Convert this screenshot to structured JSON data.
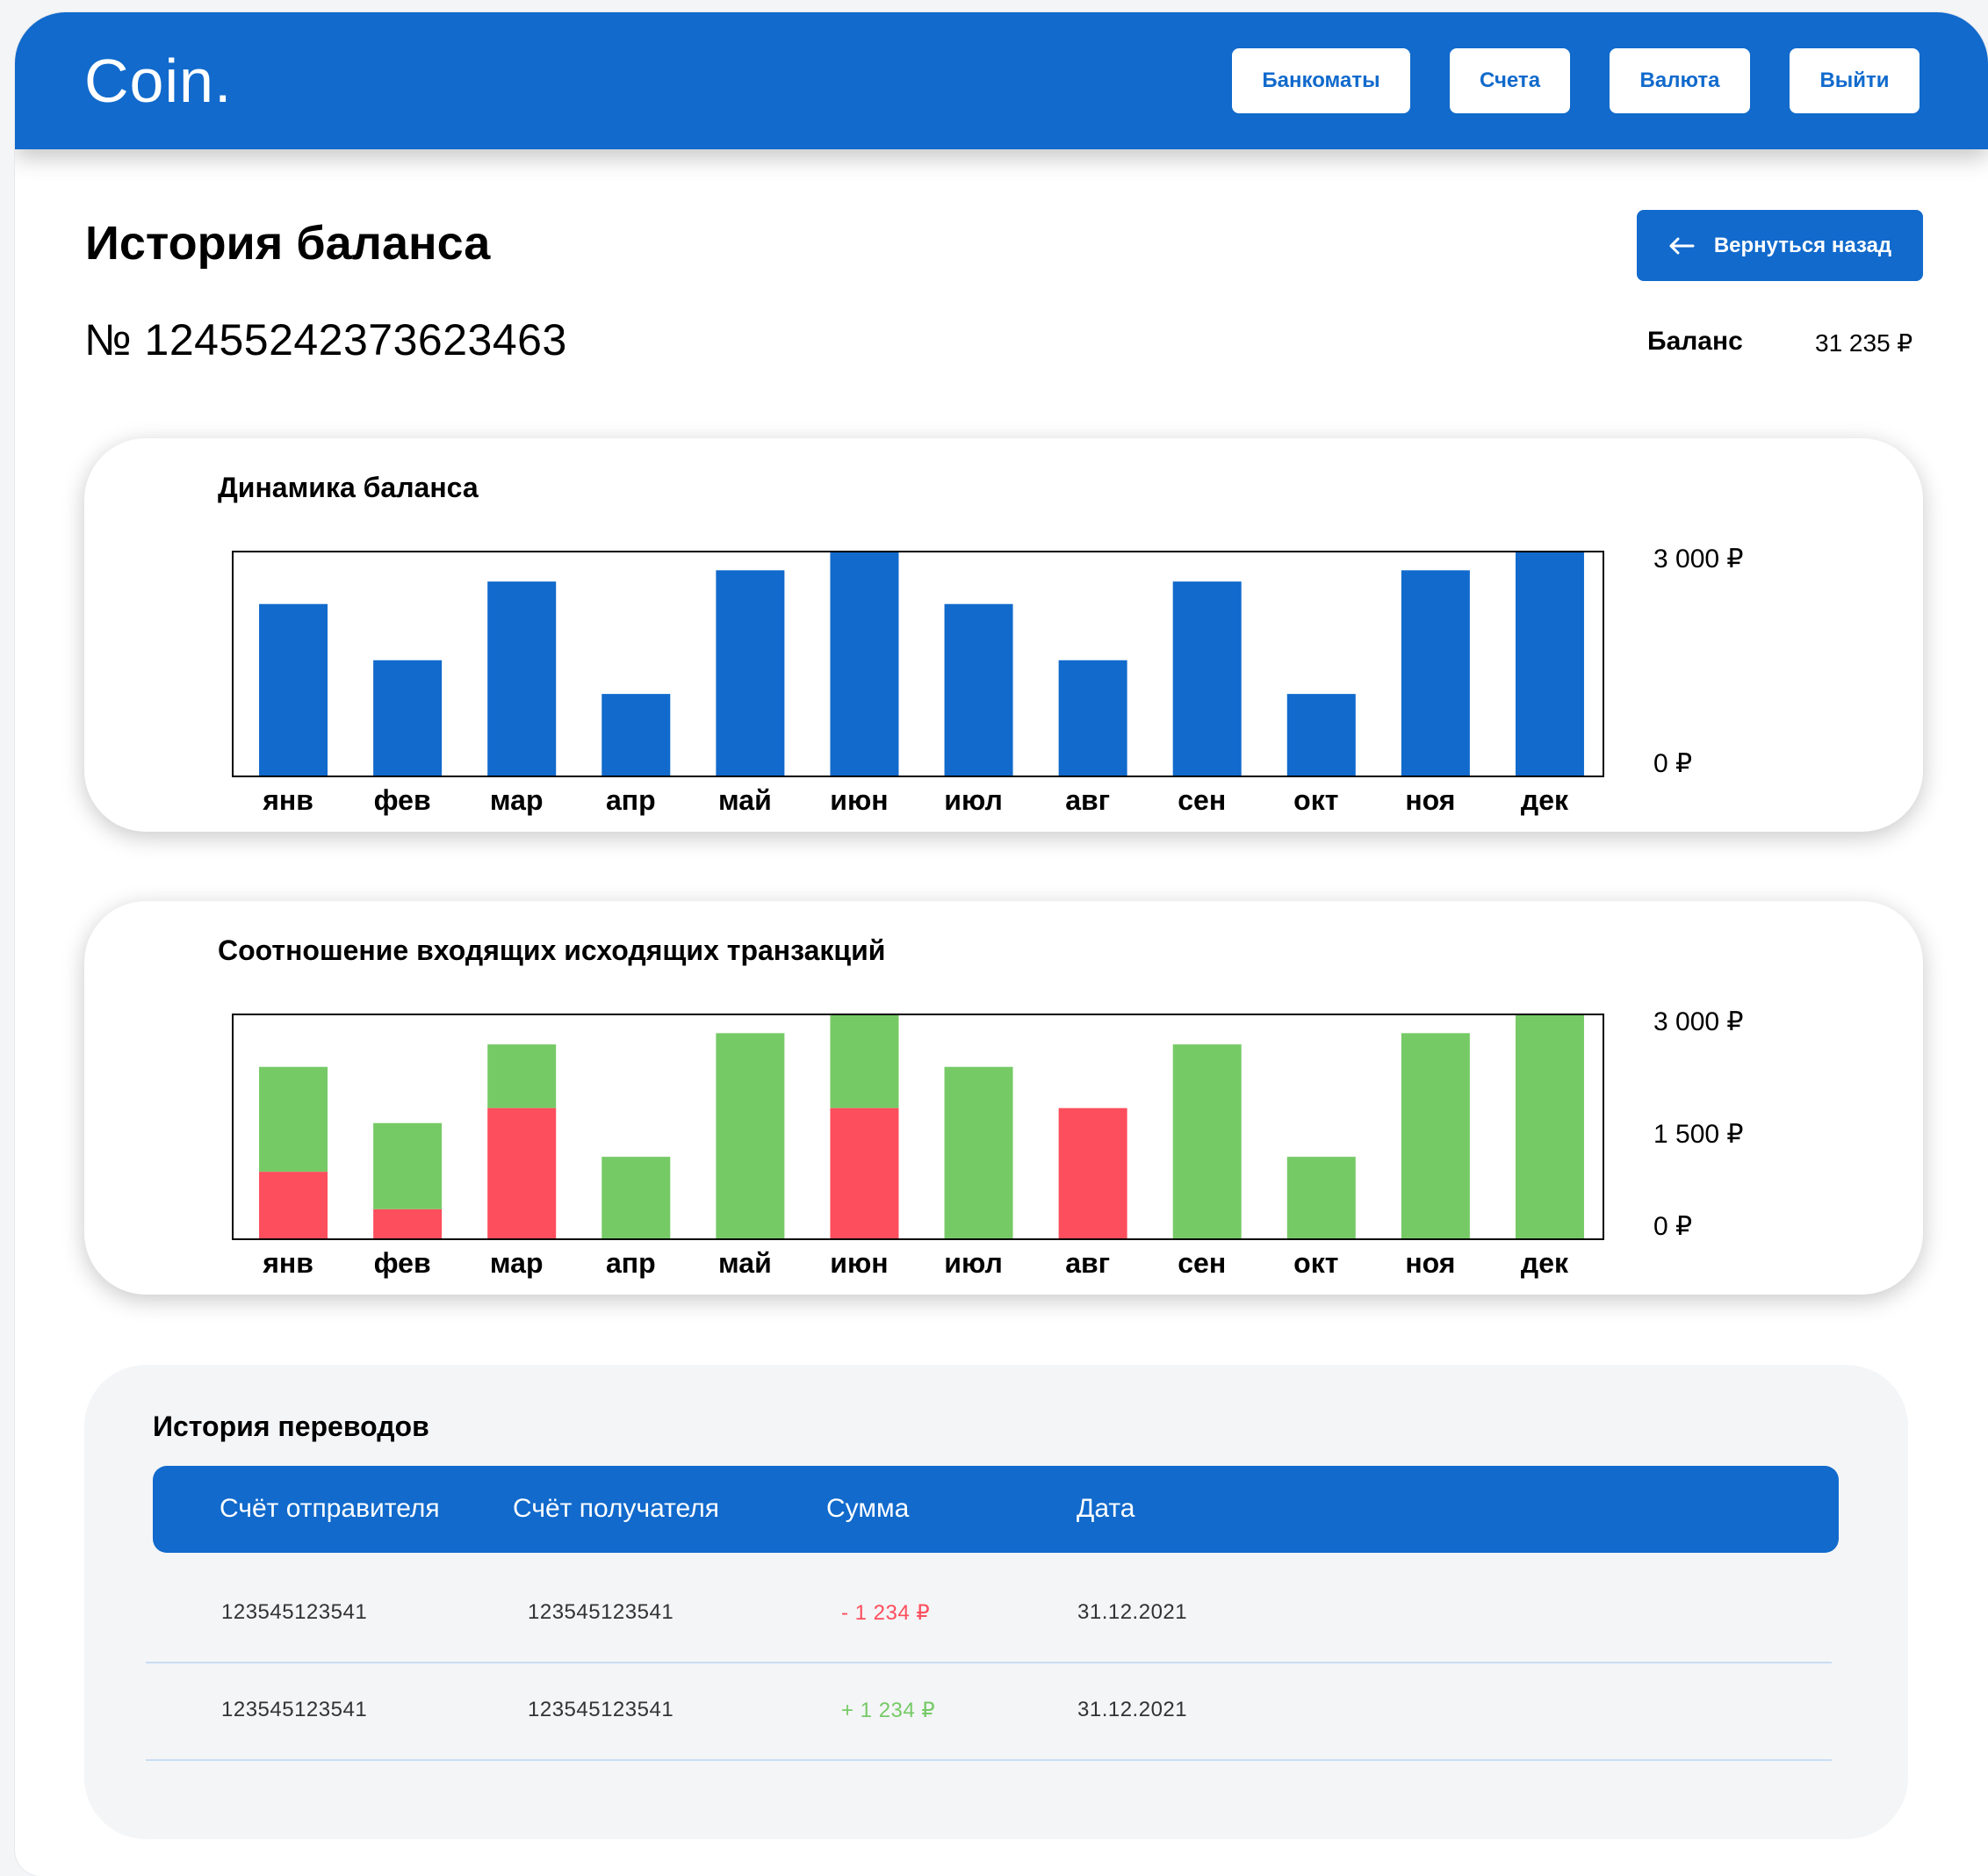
{
  "header": {
    "logo": "Coin.",
    "nav": [
      "Банкоматы",
      "Счета",
      "Валюта",
      "Выйти"
    ]
  },
  "page": {
    "title": "История баланса",
    "back_label": "Вернуться назад",
    "account_number": "№ 12455242373623463",
    "balance_label": "Баланс",
    "balance_value": "31 235 ₽"
  },
  "colors": {
    "primary": "#116acc",
    "incoming": "#76ca66",
    "outgoing": "#fd4e5d"
  },
  "chart_data": [
    {
      "type": "bar",
      "title": "Динамика баланса",
      "categories": [
        "янв",
        "фев",
        "мар",
        "апр",
        "май",
        "июн",
        "июл",
        "авг",
        "сен",
        "окт",
        "ноя",
        "дек"
      ],
      "values": [
        2300,
        1550,
        2600,
        1100,
        2750,
        3000,
        2300,
        1550,
        2600,
        1100,
        2750,
        3000
      ],
      "ylim": [
        0,
        3000
      ],
      "y_ticks": [
        {
          "value": 3000,
          "label": "3 000  ₽"
        },
        {
          "value": 0,
          "label": "0 ₽"
        }
      ]
    },
    {
      "type": "bar",
      "stacked": true,
      "title": "Соотношение входящих исходящих транзакций",
      "categories": [
        "янв",
        "фев",
        "мар",
        "апр",
        "май",
        "июн",
        "июл",
        "авг",
        "сен",
        "окт",
        "ноя",
        "дек"
      ],
      "series": [
        {
          "values": [
            900,
            400,
            1750,
            0,
            0,
            1750,
            0,
            1750,
            0,
            0,
            0,
            0
          ]
        },
        {
          "values": [
            1400,
            1150,
            850,
            1100,
            2750,
            1250,
            2300,
            0,
            2600,
            1100,
            2750,
            3000
          ]
        }
      ],
      "ylim": [
        0,
        3000
      ],
      "y_ticks": [
        {
          "value": 3000,
          "label": "3 000 ₽"
        },
        {
          "value": 1500,
          "label": "1 500 ₽"
        },
        {
          "value": 0,
          "label": "0 ₽"
        }
      ]
    }
  ],
  "transfers": {
    "title": "История переводов",
    "columns": [
      "Счёт отправителя",
      "Счёт получателя",
      "Сумма",
      "Дата"
    ],
    "rows": [
      {
        "from": "123545123541",
        "to": "123545123541",
        "amount": "- 1 234  ₽",
        "date": "31.12.2021",
        "direction": "out"
      },
      {
        "from": "123545123541",
        "to": "123545123541",
        "amount": "+ 1 234  ₽",
        "date": "31.12.2021",
        "direction": "in"
      }
    ]
  }
}
